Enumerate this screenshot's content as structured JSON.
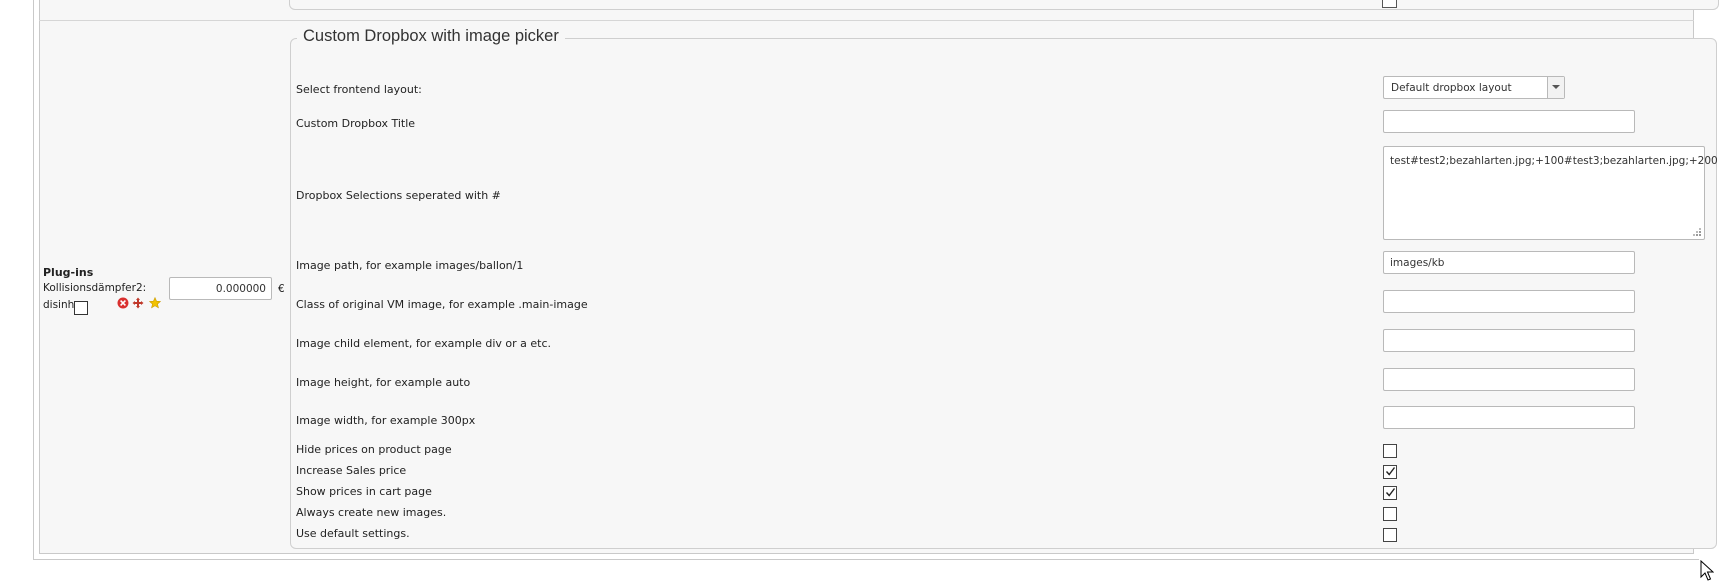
{
  "plugins": {
    "title": "Plug-ins",
    "field_label": "Kollisionsdämpfer2:",
    "disinh_label": "disinh:",
    "price_value": "0.000000",
    "currency": "€",
    "disinh_checked": false
  },
  "fieldset": {
    "legend": "Custom Dropbox with image picker",
    "layout": {
      "label": "Select frontend layout:",
      "selected": "Default dropbox layout"
    },
    "title_field": {
      "label": "Custom Dropbox Title",
      "value": ""
    },
    "selections": {
      "label": "Dropbox Selections seperated with #",
      "value": "test#test2;bezahlarten.jpg;+100#test3;bezahlarten.jpg;+200"
    },
    "image_path": {
      "label": "Image path, for example images/ballon/1",
      "value": "images/kb"
    },
    "image_class": {
      "label": "Class of original VM image, for example .main-image",
      "value": ""
    },
    "image_child": {
      "label": "Image child element, for example div or a etc.",
      "value": ""
    },
    "image_height": {
      "label": "Image height, for example auto",
      "value": ""
    },
    "image_width": {
      "label": "Image width, for example 300px",
      "value": ""
    },
    "checkboxes": [
      {
        "label": "Hide prices on product page",
        "checked": false
      },
      {
        "label": "Increase Sales price",
        "checked": true
      },
      {
        "label": "Show prices in cart page",
        "checked": true
      },
      {
        "label": "Always create new images.",
        "checked": false
      },
      {
        "label": "Use default settings.",
        "checked": false
      }
    ]
  },
  "icons": {
    "remove": "remove-icon",
    "move": "move-icon",
    "favorite": "star-icon",
    "resize": "resize-grip-icon",
    "cursor": "mouse-cursor-icon"
  },
  "colors": {
    "background": "#f7f7f7",
    "border": "#cfcfcf",
    "remove_icon": "#d9302f",
    "star_icon": "#f2c200"
  }
}
